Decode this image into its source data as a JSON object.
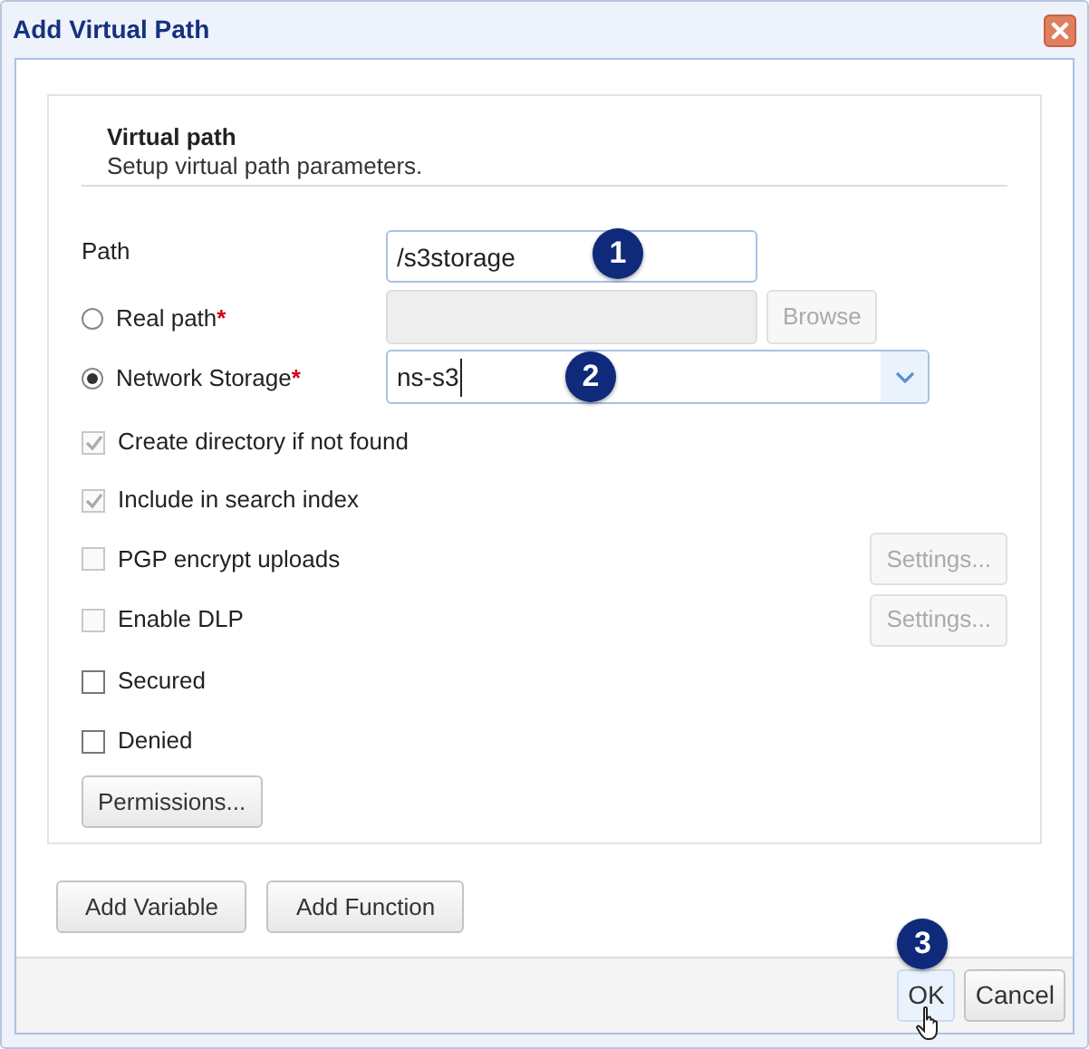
{
  "window": {
    "title": "Add Virtual Path"
  },
  "section": {
    "title": "Virtual path",
    "subtitle": "Setup virtual path parameters."
  },
  "path": {
    "label": "Path",
    "value": "/s3storage",
    "callout": "1"
  },
  "sources": [
    {
      "kind": "folder",
      "label": "Real path",
      "required_mark": "*",
      "selected": false,
      "disabled": true,
      "button": {
        "label": "Browse",
        "disabled": true
      }
    },
    {
      "kind": "dropdown",
      "label": "Network Storage",
      "required_mark": "*",
      "selected": true,
      "disabled": false,
      "value": "ns-s3",
      "callout": "2"
    }
  ],
  "options": [
    {
      "label": "Create directory if not found",
      "checked": true,
      "disabled": true
    },
    {
      "label": "Include in search index",
      "checked": true,
      "disabled": true
    },
    {
      "label": "PGP encrypt uploads",
      "checked": false,
      "disabled": true,
      "button": {
        "label": "Settings...",
        "disabled": true
      }
    },
    {
      "label": "Enable DLP",
      "checked": false,
      "disabled": true,
      "button": {
        "label": "Settings...",
        "disabled": true
      }
    },
    {
      "label": "Secured",
      "checked": false,
      "disabled": false
    },
    {
      "label": "Denied",
      "checked": false,
      "disabled": false
    }
  ],
  "permissions_button": "Permissions...",
  "bottom_buttons": [
    "Add Variable",
    "Add Function"
  ],
  "footer_buttons": [
    {
      "label": "OK",
      "hovered": true,
      "callout": "3"
    },
    {
      "label": "Cancel",
      "hovered": false
    }
  ]
}
